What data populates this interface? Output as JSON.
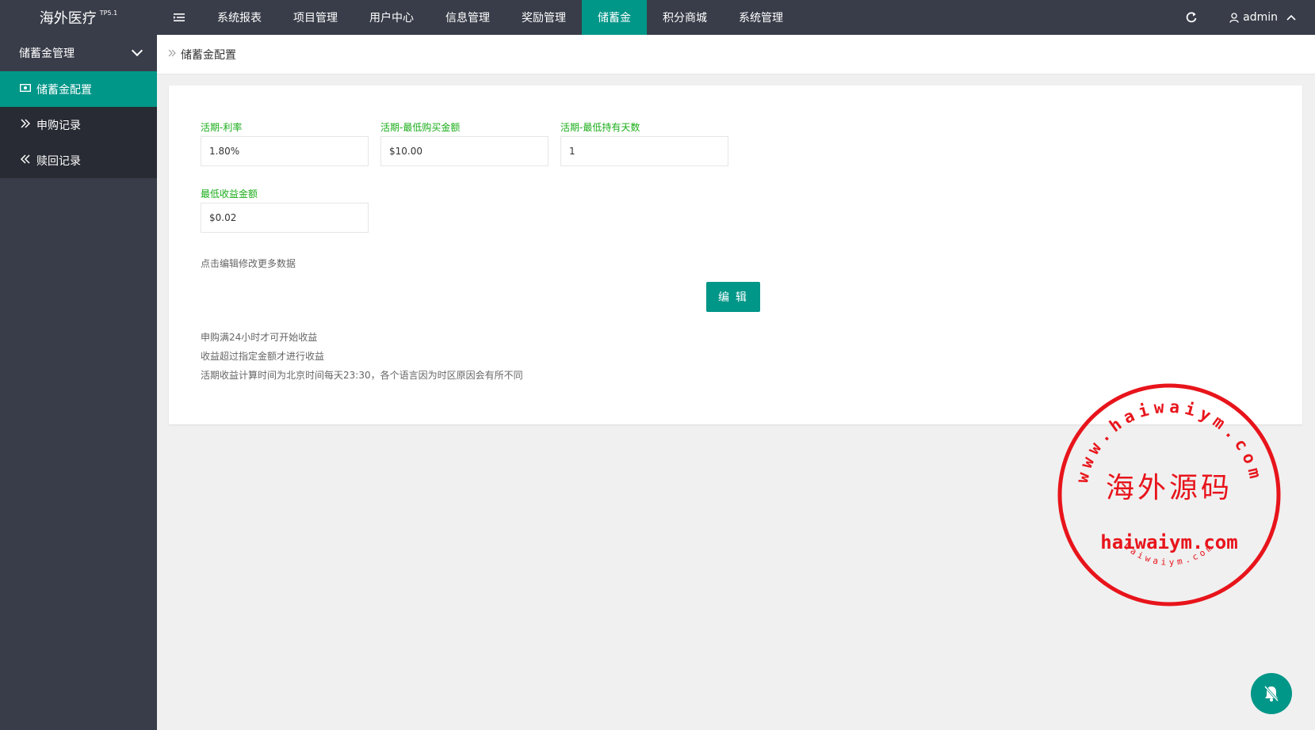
{
  "app": {
    "title": "海外医疗",
    "version": "TP5.1"
  },
  "topnav": {
    "items": [
      {
        "label": "系统报表"
      },
      {
        "label": "项目管理"
      },
      {
        "label": "用户中心"
      },
      {
        "label": "信息管理"
      },
      {
        "label": "奖励管理"
      },
      {
        "label": "储蓄金",
        "active": true
      },
      {
        "label": "积分商城"
      },
      {
        "label": "系统管理"
      }
    ],
    "user": "admin"
  },
  "sidebar": {
    "group_label": "储蓄金管理",
    "items": [
      {
        "label": "储蓄金配置",
        "icon": "money-icon",
        "active": true
      },
      {
        "label": "申购记录",
        "icon": "double-chevron-right-icon"
      },
      {
        "label": "赎回记录",
        "icon": "double-chevron-left-icon"
      }
    ]
  },
  "breadcrumb": {
    "current": "储蓄金配置"
  },
  "form": {
    "rate": {
      "label": "活期-利率",
      "value": "1.80%"
    },
    "min_purchase": {
      "label": "活期-最低购买金额",
      "value": "$10.00"
    },
    "min_days": {
      "label": "活期-最低持有天数",
      "value": "1"
    },
    "min_earning": {
      "label": "最低收益金额",
      "value": "$0.02"
    },
    "edit_hint": "点击编辑修改更多数据",
    "edit_button": "编 辑"
  },
  "notes": [
    "申购满24小时才可开始收益",
    "收益超过指定金额才进行收益",
    "活期收益计算时间为北京时间每天23:30，各个语言因为时区原因会有所不同"
  ],
  "watermark": {
    "outer_text": "www.haiwaiym.com",
    "center_text": "海外源码",
    "domain_text": "haiwaiym.com",
    "bottom_text": "haiwaiym.com"
  },
  "colors": {
    "topbar": "#393d49",
    "accent": "#009688",
    "label_green": "#1aad19",
    "stamp_red": "#e8141b"
  }
}
